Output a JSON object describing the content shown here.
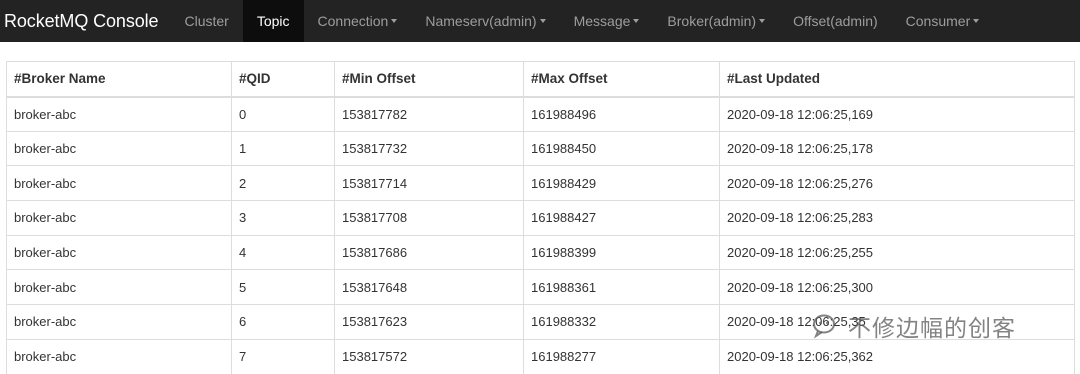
{
  "navbar": {
    "brand": "RocketMQ Console",
    "items": [
      {
        "label": "Cluster",
        "active": false,
        "dropdown": false
      },
      {
        "label": "Topic",
        "active": true,
        "dropdown": false
      },
      {
        "label": "Connection",
        "active": false,
        "dropdown": true
      },
      {
        "label": "Nameserv(admin)",
        "active": false,
        "dropdown": true
      },
      {
        "label": "Message",
        "active": false,
        "dropdown": true
      },
      {
        "label": "Broker(admin)",
        "active": false,
        "dropdown": true
      },
      {
        "label": "Offset(admin)",
        "active": false,
        "dropdown": false
      },
      {
        "label": "Consumer",
        "active": false,
        "dropdown": true
      }
    ]
  },
  "table": {
    "headers": [
      "#Broker Name",
      "#QID",
      "#Min Offset",
      "#Max Offset",
      "#Last Updated"
    ],
    "rows": [
      [
        "broker-abc",
        "0",
        "153817782",
        "161988496",
        "2020-09-18 12:06:25,169"
      ],
      [
        "broker-abc",
        "1",
        "153817732",
        "161988450",
        "2020-09-18 12:06:25,178"
      ],
      [
        "broker-abc",
        "2",
        "153817714",
        "161988429",
        "2020-09-18 12:06:25,276"
      ],
      [
        "broker-abc",
        "3",
        "153817708",
        "161988427",
        "2020-09-18 12:06:25,283"
      ],
      [
        "broker-abc",
        "4",
        "153817686",
        "161988399",
        "2020-09-18 12:06:25,255"
      ],
      [
        "broker-abc",
        "5",
        "153817648",
        "161988361",
        "2020-09-18 12:06:25,300"
      ],
      [
        "broker-abc",
        "6",
        "153817623",
        "161988332",
        "2020-09-18 12:06:25,35"
      ],
      [
        "broker-abc",
        "7",
        "153817572",
        "161988277",
        "2020-09-18 12:06:25,362"
      ]
    ]
  },
  "watermark": {
    "text": "不修边幅的创客",
    "icon": "wechat-icon"
  },
  "colors": {
    "navbar_bg": "#232323",
    "navbar_active_bg": "#0d0d0d",
    "nav_text": "#9d9d9d",
    "table_border": "#dddddd"
  }
}
